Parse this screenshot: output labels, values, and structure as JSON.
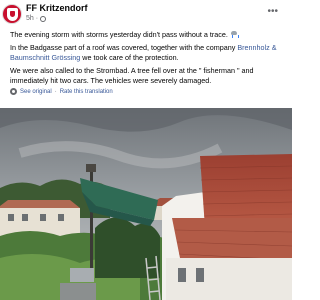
{
  "post": {
    "page_name": "FF Kritzendorf",
    "time": "5h",
    "visibility_icon": "globe-icon",
    "more_icon": "more-options-icon",
    "paragraphs": {
      "p1": "The evening storm with storms yesterday didn't pass without a trace.",
      "p1_emoji": "cloud-rain-icon",
      "p2_before": "In the Badgasse part of a roof was covered, together with the company ",
      "p2_link": "Brennholz & Baumschnitt Grössing",
      "p2_after": " we took care of the protection.",
      "p3": "We were also called to the Strombad. A tree fell over at the \" fisherman \" and immediately hit two cars. The vehicles were severely damaged."
    },
    "translation": {
      "see_original": "See original",
      "separator": "·",
      "rate": "Rate this translation"
    },
    "photo": {
      "description_icon": "storm-damage-photo"
    }
  },
  "colors": {
    "link": "#385898",
    "secondary_text": "#65676b",
    "avatar_red": "#c8102e",
    "roof_red": "#a94b3a",
    "tarp_green": "#2f6b55"
  }
}
